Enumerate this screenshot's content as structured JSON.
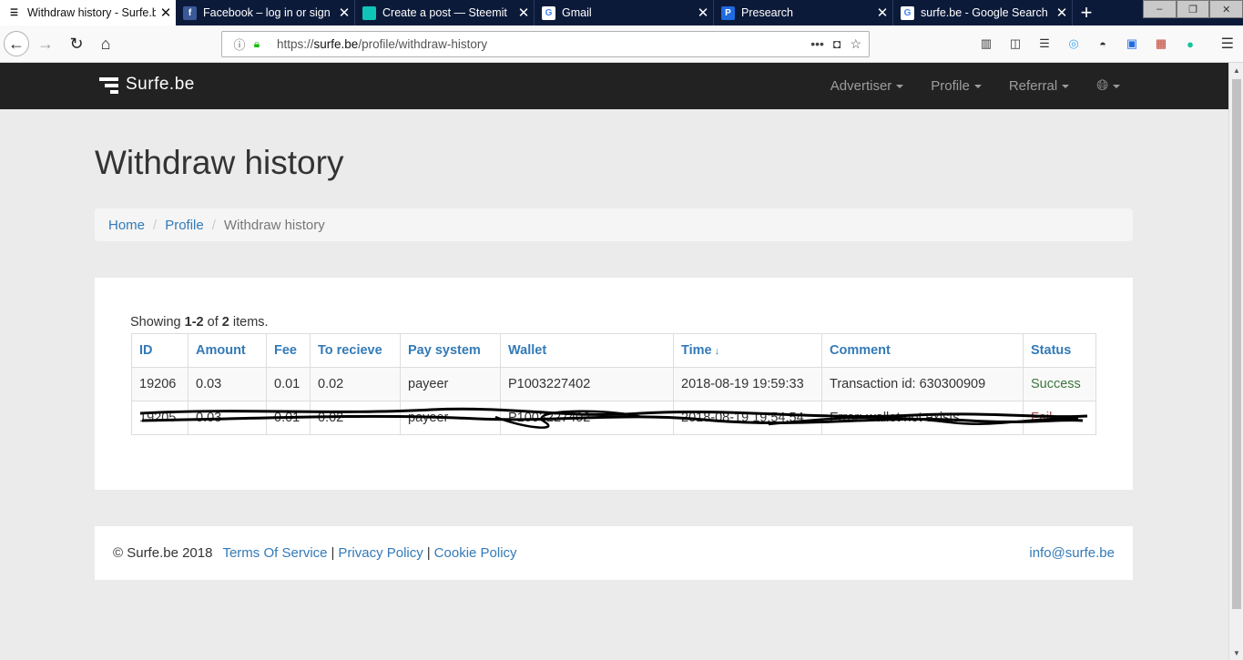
{
  "browser": {
    "tabs": [
      {
        "title": "Withdraw history - Surfe.b",
        "favicon": "surfe-icon",
        "active": true
      },
      {
        "title": "Facebook – log in or sign",
        "favicon": "facebook-icon",
        "active": false
      },
      {
        "title": "Create a post — Steemit",
        "favicon": "steemit-icon",
        "active": false
      },
      {
        "title": "Gmail",
        "favicon": "google-icon",
        "active": false
      },
      {
        "title": "Presearch",
        "favicon": "presearch-icon",
        "active": false
      },
      {
        "title": "surfe.be - Google Search",
        "favicon": "google-icon",
        "active": false
      }
    ],
    "url_prefix": "https://",
    "url_host": "surfe.be",
    "url_path": "/profile/withdraw-history"
  },
  "site": {
    "brand": "Surfe.be",
    "menu": [
      "Advertiser",
      "Profile",
      "Referral"
    ]
  },
  "page": {
    "title": "Withdraw history",
    "breadcrumb": [
      "Home",
      "Profile",
      "Withdraw history"
    ]
  },
  "summary": {
    "prefix": "Showing ",
    "range": "1-2",
    "of": " of ",
    "total": "2",
    "suffix": " items."
  },
  "table": {
    "columns": [
      "ID",
      "Amount",
      "Fee",
      "To recieve",
      "Pay system",
      "Wallet",
      "Time",
      "Comment",
      "Status"
    ],
    "rows": [
      [
        "19206",
        "0.03",
        "0.01",
        "0.02",
        "payeer",
        "P1003227402",
        "2018-08-19 19:59:33",
        "Transaction id: 630300909",
        "Success"
      ],
      [
        "19205",
        "0.03",
        "0.01",
        "0.02",
        "payeer",
        "P1003227402",
        "2018-08-19 19:54:54",
        "Error: wallet not exists",
        "Fail"
      ]
    ]
  },
  "footer": {
    "copyright": "© Surfe.be 2018",
    "links": [
      "Terms Of Service",
      "Privacy Policy",
      "Cookie Policy"
    ],
    "email": "info@surfe.be"
  },
  "colors": {
    "link": "#337ab7",
    "success": "#3c763d",
    "fail": "#a94442",
    "navbar": "#222222"
  }
}
